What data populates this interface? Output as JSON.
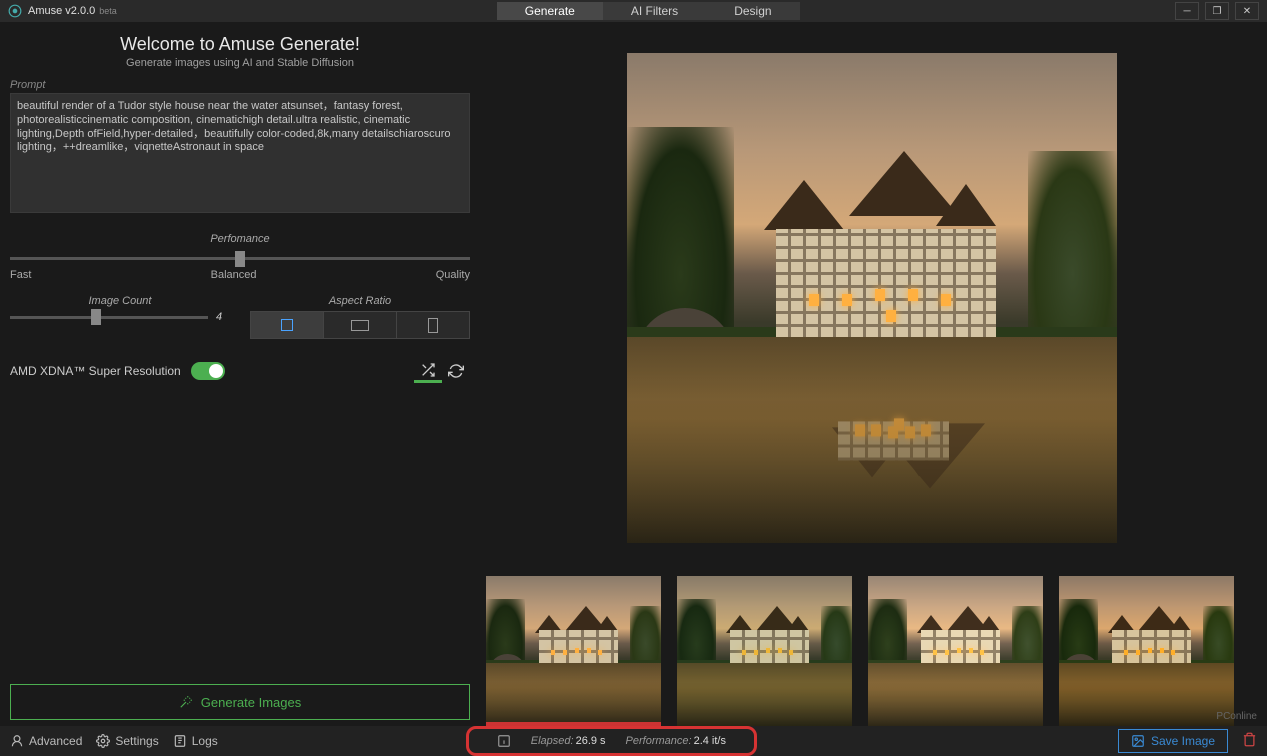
{
  "app": {
    "name": "Amuse v2.0.0",
    "tag": "beta"
  },
  "tabs": {
    "generate": "Generate",
    "filters": "AI Filters",
    "design": "Design"
  },
  "welcome": {
    "title": "Welcome to Amuse Generate!",
    "subtitle": "Generate images using AI and Stable Diffusion"
  },
  "prompt": {
    "label": "Prompt",
    "value": "beautiful render of a Tudor style house near the water atsunset，fantasy forest, photorealisticcinematic composition, cinematichigh detail.ultra realistic, cinematic lighting,Depth ofField,hyper-detailed，beautifully color-coded,8k,many detailschiaroscuro lighting，++dreamlike，viqnetteAstronaut in space"
  },
  "performance": {
    "label": "Perfomance",
    "left": "Fast",
    "mid": "Balanced",
    "right": "Quality"
  },
  "imageCount": {
    "label": "Image Count",
    "value": "4"
  },
  "aspect": {
    "label": "Aspect Ratio"
  },
  "superRes": {
    "label": "AMD XDNA™ Super Resolution"
  },
  "generate": {
    "label": "Generate Images"
  },
  "bottom": {
    "advanced": "Advanced",
    "settings": "Settings",
    "logs": "Logs",
    "elapsedLabel": "Elapsed:",
    "elapsedVal": "26.9 s",
    "perfLabel": "Performance:",
    "perfVal": "2.4 it/s",
    "save": "Save Image"
  },
  "watermark": "PConline"
}
